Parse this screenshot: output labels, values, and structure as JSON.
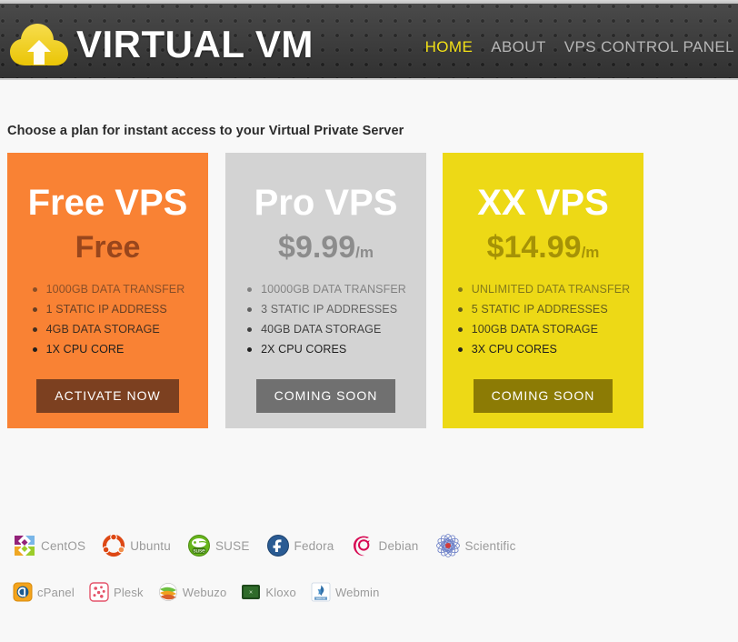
{
  "header": {
    "brand_name": "VIRTUAL VM",
    "logo_icon": "cloud-upload-icon",
    "logo_color": "#f2d016",
    "background_color": "#3c3c3c",
    "nav": [
      {
        "label": "HOME",
        "active": true
      },
      {
        "label": "ABOUT",
        "active": false
      },
      {
        "label": "VPS CONTROL PANEL",
        "active": false
      }
    ],
    "active_nav_color": "#f2e016",
    "inactive_nav_color": "#b6b6b6"
  },
  "main": {
    "tagline": "Choose a plan for instant access to your Virtual Private Server",
    "plans": [
      {
        "name": "Free VPS",
        "price": "Free",
        "price_period": "",
        "card_color": "#f98234",
        "price_color": "#99461c",
        "button_color": "#7c4020",
        "cta_label": "ACTIVATE NOW",
        "features": [
          "1000GB DATA TRANSFER",
          "1 STATIC IP ADDRESS",
          "4GB DATA STORAGE",
          "1X CPU CORE"
        ]
      },
      {
        "name": "Pro VPS",
        "price": "$9.99",
        "price_period": "/m",
        "card_color": "#d3d3d3",
        "price_color": "#8c8c8c",
        "button_color": "#707070",
        "cta_label": "COMING SOON",
        "features": [
          "10000GB DATA TRANSFER",
          "3 STATIC IP ADDRESSES",
          "40GB DATA STORAGE",
          "2X CPU CORES"
        ]
      },
      {
        "name": "XX VPS",
        "price": "$14.99",
        "price_period": "/m",
        "card_color": "#edd916",
        "price_color": "#a59206",
        "button_color": "#8c7b05",
        "cta_label": "COMING SOON",
        "features": [
          "UNLIMITED DATA TRANSFER",
          "5 STATIC IP ADDRESSES",
          "100GB DATA STORAGE",
          "3X CPU CORES"
        ]
      }
    ]
  },
  "footer": {
    "operating_systems": [
      {
        "label": "CentOS",
        "icon": "centos-logo-icon"
      },
      {
        "label": "Ubuntu",
        "icon": "ubuntu-logo-icon"
      },
      {
        "label": "SUSE",
        "icon": "suse-logo-icon"
      },
      {
        "label": "Fedora",
        "icon": "fedora-logo-icon"
      },
      {
        "label": "Debian",
        "icon": "debian-logo-icon"
      },
      {
        "label": "Scientific",
        "icon": "scientific-linux-logo-icon"
      }
    ],
    "control_panels": [
      {
        "label": "cPanel",
        "icon": "cpanel-logo-icon"
      },
      {
        "label": "Plesk",
        "icon": "plesk-logo-icon"
      },
      {
        "label": "Webuzo",
        "icon": "webuzo-logo-icon"
      },
      {
        "label": "Kloxo",
        "icon": "kloxo-logo-icon"
      },
      {
        "label": "Webmin",
        "icon": "webmin-logo-icon"
      }
    ],
    "label_color": "#9a9a9a"
  }
}
